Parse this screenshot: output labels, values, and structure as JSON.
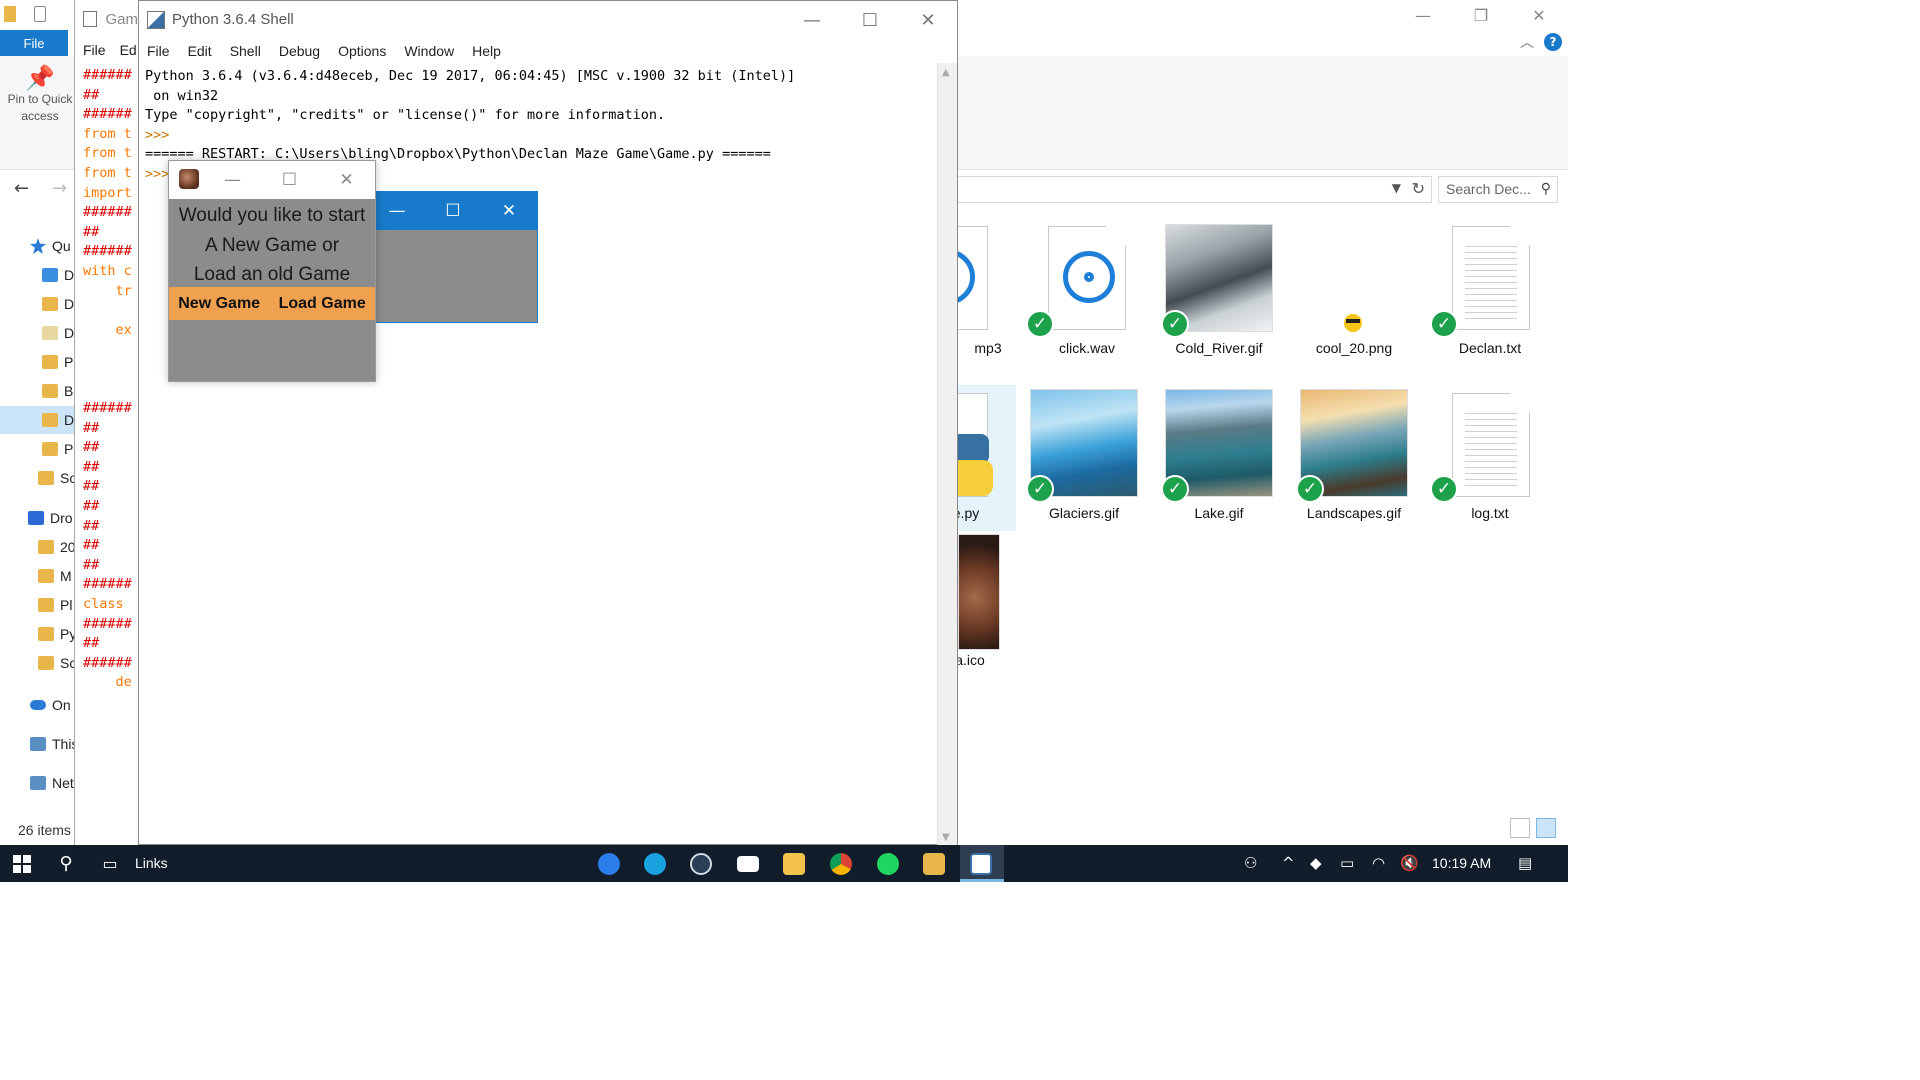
{
  "explorer": {
    "ribbon": {
      "file_tab": "File",
      "pin_label": "Pin to Quick access"
    },
    "search_placeholder": "Search Dec...",
    "nav_items": [
      "Qu",
      "D",
      "D",
      "D",
      "Pi",
      "Bi",
      "D",
      "Pi",
      "Sc",
      "Dro",
      "20",
      "M",
      "Pl",
      "Py",
      "Sc",
      "On",
      "This",
      "Net"
    ],
    "status": "26 items",
    "files": [
      {
        "name": "mp3"
      },
      {
        "name": "click.wav"
      },
      {
        "name": "Cold_River.gif"
      },
      {
        "name": "cool_20.png"
      },
      {
        "name": "Declan.txt"
      },
      {
        "name": "e.py"
      },
      {
        "name": "Glaciers.gif"
      },
      {
        "name": "Lake.gif"
      },
      {
        "name": "Landscapes.gif"
      },
      {
        "name": "log.txt"
      },
      {
        "name": "a.ico"
      }
    ]
  },
  "editor": {
    "title": "Gam",
    "menu": [
      "File",
      "Ed"
    ],
    "lines": [
      {
        "t": "######",
        "c": "hash"
      },
      {
        "t": "##",
        "c": "hash"
      },
      {
        "t": "######",
        "c": "hash"
      },
      {
        "t": "from t",
        "c": "kw"
      },
      {
        "t": "from t",
        "c": "kw"
      },
      {
        "t": "from t",
        "c": "kw"
      },
      {
        "t": "import",
        "c": "kw"
      },
      {
        "t": "######",
        "c": "hash"
      },
      {
        "t": "##",
        "c": "hash"
      },
      {
        "t": "######",
        "c": "hash"
      },
      {
        "t": "with c",
        "c": "kw"
      },
      {
        "t": "    tr",
        "c": "kw"
      },
      {
        "t": "",
        "c": ""
      },
      {
        "t": "    ex",
        "c": "kw"
      },
      {
        "t": "",
        "c": ""
      },
      {
        "t": "",
        "c": ""
      },
      {
        "t": "",
        "c": ""
      },
      {
        "t": "######",
        "c": "hash"
      },
      {
        "t": "##",
        "c": "hash"
      },
      {
        "t": "##",
        "c": "hash"
      },
      {
        "t": "##",
        "c": "hash"
      },
      {
        "t": "##",
        "c": "hash"
      },
      {
        "t": "##",
        "c": "hash"
      },
      {
        "t": "##",
        "c": "hash"
      },
      {
        "t": "##",
        "c": "hash"
      },
      {
        "t": "##",
        "c": "hash"
      },
      {
        "t": "######",
        "c": "hash"
      },
      {
        "t": "class ",
        "c": "kw"
      },
      {
        "t": "######",
        "c": "hash"
      },
      {
        "t": "##",
        "c": "hash"
      },
      {
        "t": "######",
        "c": "hash"
      },
      {
        "t": "    de",
        "c": "kw"
      }
    ]
  },
  "shell": {
    "title": "Python 3.6.4 Shell",
    "menu": [
      "File",
      "Edit",
      "Shell",
      "Debug",
      "Options",
      "Window",
      "Help"
    ],
    "line1": "Python 3.6.4 (v3.6.4:d48eceb, Dec 19 2017, 06:04:45) [MSC v.1900 32 bit (Intel)]",
    "line2": " on win32",
    "line3": "Type \"copyright\", \"credits\" or \"license()\" for more information.",
    "prompt": ">>>",
    "restart": "====== RESTART: C:\\Users\\bling\\Dropbox\\Python\\Declan Maze Game\\Game.py ======"
  },
  "dialog": {
    "message_lines": [
      "Would you like to start",
      "A New Game or",
      "Load an old Game"
    ],
    "new_game": "New Game",
    "load_game": "Load Game"
  },
  "taskbar": {
    "links": "Links",
    "time": "10:19 AM"
  }
}
